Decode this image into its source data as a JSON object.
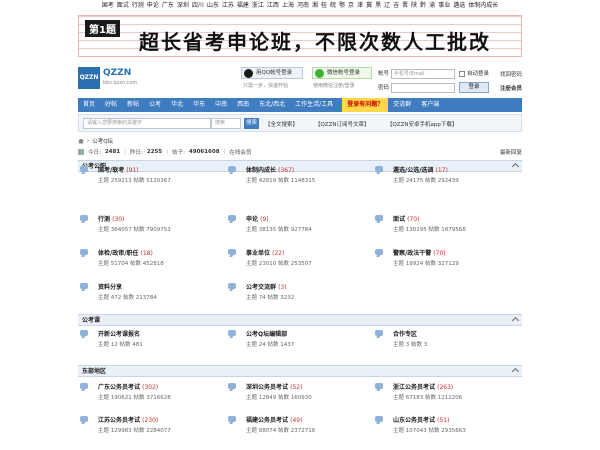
{
  "topnav": [
    "国考",
    "面试",
    "行测",
    "申论",
    "广东",
    "深圳",
    "四川",
    "山东",
    "江苏",
    "福建",
    "浙江",
    "江西",
    "上海",
    "河南",
    "湘",
    "桂",
    "皖",
    "鄂",
    "京",
    "津",
    "冀",
    "黑",
    "辽",
    "吉",
    "晋",
    "陕",
    "黔",
    "渝",
    "事业",
    "遴选",
    "体制内成长"
  ],
  "banner": {
    "badge": "第1题",
    "text": "超长省考申论班，不限次数人工批改"
  },
  "logo": {
    "mark": "QZZN",
    "name": "QZZN",
    "domain": "bbs.qzzn.com"
  },
  "qq": {
    "label": "用QQ帐号登录",
    "hint": "只需一步，快速开始"
  },
  "wechat": {
    "label": "微信帐号登录",
    "hint": "使用微信注册/登录"
  },
  "login": {
    "account_label": "帐号",
    "account_placeholder": "手机号/Email",
    "auto_login": "自动登录",
    "forgot": "找回密码",
    "password_label": "密码",
    "submit": "登录",
    "register": "注册会员"
  },
  "mainnav": [
    "首页",
    "好帖",
    "新帖",
    "公考",
    "华北",
    "华东",
    "中南",
    "西南",
    "东北/西北",
    "工作生活/工具",
    "登录有问题？",
    "交流群",
    "客户端"
  ],
  "search": {
    "placeholder": "请输入您要搜索的关键字",
    "scope": "搜索",
    "button": "搜索",
    "links": [
      "【全文搜索】",
      "【QZZN订阅号文章】",
      "【QZZN安卓手机app下载】"
    ]
  },
  "breadcrumb": {
    "label": "公考Q坛"
  },
  "stats": {
    "today_label": "今日:",
    "today": "2481",
    "yesterday_label": "昨日:",
    "yesterday": "2255",
    "posts_label": "帖子:",
    "posts": "49061608",
    "online": "在线会员"
  },
  "newest_reply": "最新回复",
  "sections": [
    {
      "title": "公考公职",
      "forums": [
        {
          "name": "国考/联考",
          "count": "(91)",
          "stats": "主题 259213  帖数 5120367"
        },
        {
          "name": "体制内成长",
          "count": "(367)",
          "stats": "主题 42819  帖数 1148315"
        },
        {
          "name": "遴选/公选/选调",
          "count": "(17)",
          "stats": "主题 24175  帖数 292439"
        },
        {
          "name": "行测",
          "count": "(30)",
          "stats": "主题 364057  帖数 7909753"
        },
        {
          "name": "申论",
          "count": "(9)",
          "stats": "主题 38135  帖数 927784"
        },
        {
          "name": "面试",
          "count": "(70)",
          "stats": "主题 130195  帖数 1879568"
        },
        {
          "name": "体检/政审/职任",
          "count": "(18)",
          "stats": "主题 51704  帖数 452818"
        },
        {
          "name": "事业单位",
          "count": "(22)",
          "stats": "主题 23010  帖数 253507"
        },
        {
          "name": "警察/政法干警",
          "count": "(70)",
          "stats": "主题 19924  帖数 327129"
        },
        {
          "name": "资料分享",
          "count": "",
          "stats": "主题 472  帖数 213784"
        },
        {
          "name": "公考交流群",
          "count": "(3)",
          "stats": "主题 74  帖数 3232"
        }
      ]
    },
    {
      "title": "公考课",
      "forums": [
        {
          "name": "开新公考课报名",
          "count": "",
          "stats": "主题 12  帖数 481"
        },
        {
          "name": "公考Q坛编辑部",
          "count": "",
          "stats": "主题 24  帖数 1437"
        },
        {
          "name": "合作专区",
          "count": "",
          "stats": "主题 3  帖数 3"
        }
      ]
    },
    {
      "title": "东部地区",
      "forums": [
        {
          "name": "广东公务员考试",
          "count": "(302)",
          "stats": "主题 190621  帖数 3716628"
        },
        {
          "name": "深圳公务员考试",
          "count": "(52)",
          "stats": "主题 12849  帖数 160930"
        },
        {
          "name": "浙江公务员考试",
          "count": "(263)",
          "stats": "主题 67183  帖数 1212206"
        },
        {
          "name": "江苏公务员考试",
          "count": "(230)",
          "stats": "主题 129983  帖数 2284077"
        },
        {
          "name": "福建公务员考试",
          "count": "(49)",
          "stats": "主题 88074  帖数 2372716"
        },
        {
          "name": "山东公务员考试",
          "count": "(51)",
          "stats": "主题 107043  帖数 2935663"
        }
      ]
    }
  ]
}
